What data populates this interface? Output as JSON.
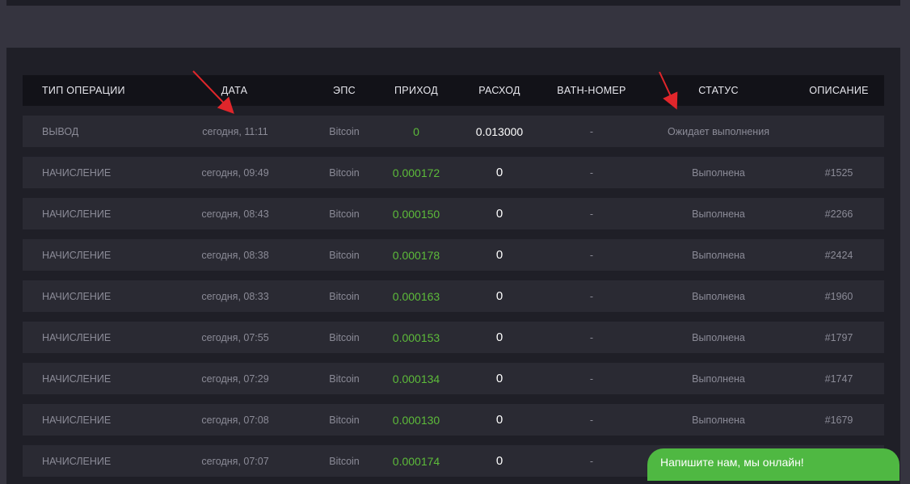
{
  "table": {
    "headers": {
      "type": "ТИП ОПЕРАЦИИ",
      "date": "ДАТА",
      "eps": "ЭПС",
      "income": "ПРИХОД",
      "expense": "РАСХОД",
      "batch": "BATH-НОМЕР",
      "status": "СТАТУС",
      "description": "ОПИСАНИЕ"
    },
    "rows": [
      {
        "type": "ВЫВОД",
        "date": "сегодня, 11:11",
        "eps": "Bitcoin",
        "income": "0",
        "expense": "0.013000",
        "batch": "-",
        "status": "Ожидает выполнения",
        "description": ""
      },
      {
        "type": "НАЧИСЛЕНИЕ",
        "date": "сегодня, 09:49",
        "eps": "Bitcoin",
        "income": "0.000172",
        "expense": "0",
        "batch": "-",
        "status": "Выполнена",
        "description": "#1525"
      },
      {
        "type": "НАЧИСЛЕНИЕ",
        "date": "сегодня, 08:43",
        "eps": "Bitcoin",
        "income": "0.000150",
        "expense": "0",
        "batch": "-",
        "status": "Выполнена",
        "description": "#2266"
      },
      {
        "type": "НАЧИСЛЕНИЕ",
        "date": "сегодня, 08:38",
        "eps": "Bitcoin",
        "income": "0.000178",
        "expense": "0",
        "batch": "-",
        "status": "Выполнена",
        "description": "#2424"
      },
      {
        "type": "НАЧИСЛЕНИЕ",
        "date": "сегодня, 08:33",
        "eps": "Bitcoin",
        "income": "0.000163",
        "expense": "0",
        "batch": "-",
        "status": "Выполнена",
        "description": "#1960"
      },
      {
        "type": "НАЧИСЛЕНИЕ",
        "date": "сегодня, 07:55",
        "eps": "Bitcoin",
        "income": "0.000153",
        "expense": "0",
        "batch": "-",
        "status": "Выполнена",
        "description": "#1797"
      },
      {
        "type": "НАЧИСЛЕНИЕ",
        "date": "сегодня, 07:29",
        "eps": "Bitcoin",
        "income": "0.000134",
        "expense": "0",
        "batch": "-",
        "status": "Выполнена",
        "description": "#1747"
      },
      {
        "type": "НАЧИСЛЕНИЕ",
        "date": "сегодня, 07:08",
        "eps": "Bitcoin",
        "income": "0.000130",
        "expense": "0",
        "batch": "-",
        "status": "Выполнена",
        "description": "#1679"
      },
      {
        "type": "НАЧИСЛЕНИЕ",
        "date": "сегодня, 07:07",
        "eps": "Bitcoin",
        "income": "0.000174",
        "expense": "0",
        "batch": "-",
        "status": "",
        "description": ""
      }
    ]
  },
  "chat_widget": {
    "label": "Напишите нам, мы онлайн!"
  },
  "colors": {
    "background": "#35343f",
    "panel": "#1f1f27",
    "header": "#121218",
    "row": "#2a2a33",
    "income_green": "#5dbb3a",
    "annotation_red": "#e0262b",
    "chat_green": "#4fb842"
  }
}
